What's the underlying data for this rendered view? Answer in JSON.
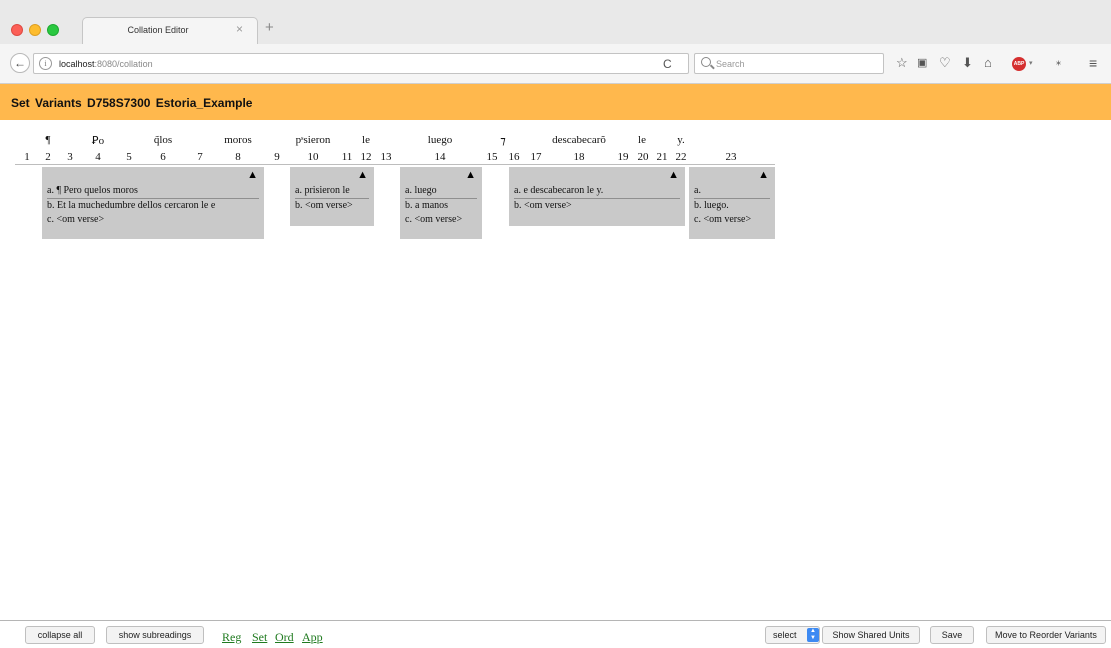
{
  "browser": {
    "tab_title": "Collation Editor",
    "tab_close": "×",
    "new_tab": "+",
    "url_host": "localhost",
    "url_rest": ":8080/collation",
    "search_placeholder": "Search",
    "icons": [
      "back-arrow-icon",
      "info-icon",
      "reload-icon",
      "search-icon",
      "star-icon",
      "reading-list-icon",
      "pocket-icon",
      "download-icon",
      "home-icon",
      "adblock-icon",
      "extension-icon",
      "menu-icon"
    ]
  },
  "header": {
    "title": "Set Variants   D758S7300   Estoria_Example",
    "background": "#ffb84d"
  },
  "collation": {
    "base_words": [
      "¶",
      "Ꝑo",
      "q̃los",
      "moros",
      "pˢsieron",
      "le",
      "luego",
      "⁊",
      "descabecarõ",
      "le",
      "y."
    ],
    "numbers": [
      "1",
      "2",
      "3",
      "4",
      "5",
      "6",
      "7",
      "8",
      "9",
      "10",
      "11",
      "12",
      "13",
      "14",
      "15",
      "16",
      "17",
      "18",
      "19",
      "20",
      "21",
      "22",
      "23"
    ],
    "variant_units": [
      {
        "toggle": "▲",
        "readings": [
          "a. ¶ Pero quelos moros",
          "b. Et la muchedumbre dellos cercaron le e",
          "c. <om verse>"
        ]
      },
      {
        "toggle": "▲",
        "readings": [
          "a. prisieron le",
          "b. <om verse>"
        ]
      },
      {
        "toggle": "▲",
        "readings": [
          "a. luego",
          "b. a manos",
          "c. <om verse>"
        ]
      },
      {
        "toggle": "▲",
        "readings": [
          "a. e descabecaron le y.",
          "b. <om verse>"
        ]
      },
      {
        "toggle": "▲",
        "readings": [
          "a.",
          "b. luego.",
          "c. <om verse>"
        ]
      }
    ],
    "unit_background": "#c9c9c9"
  },
  "footer": {
    "collapse_all": "collapse all",
    "show_subreadings": "show subreadings",
    "links": [
      "Reg",
      "Set",
      "Ord",
      "App"
    ],
    "select_label": "select",
    "show_shared_units": "Show Shared Units",
    "save": "Save",
    "move_to_reorder": "Move to Reorder Variants",
    "link_color": "#1f7a1f"
  }
}
